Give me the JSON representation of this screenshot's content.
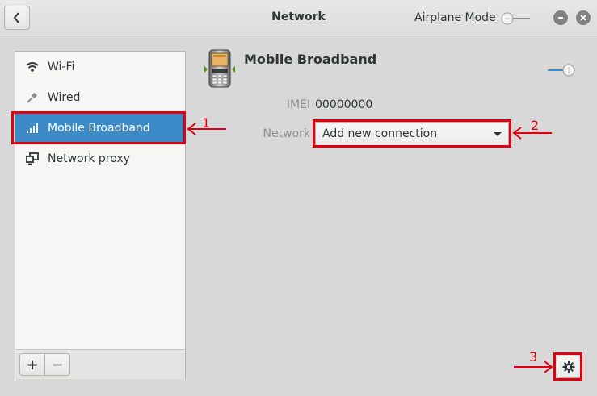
{
  "header": {
    "title": "Network",
    "airplane_mode_label": "Airplane Mode",
    "airplane_mode_on": false
  },
  "sidebar": {
    "items": [
      {
        "label": "Wi-Fi",
        "icon": "wifi-icon",
        "selected": false
      },
      {
        "label": "Wired",
        "icon": "wired-icon",
        "selected": false
      },
      {
        "label": "Mobile Broadband",
        "icon": "signal-bars-icon",
        "selected": true
      },
      {
        "label": "Network proxy",
        "icon": "network-proxy-icon",
        "selected": false
      }
    ],
    "toolbar": {
      "add_label": "+",
      "remove_label": "−"
    }
  },
  "main": {
    "section_title": "Mobile Broadband",
    "device_enabled": false,
    "imei_label": "IMEI",
    "imei_value": "00000000",
    "network_label": "Network",
    "network_value": "Add new connection"
  },
  "annotations": {
    "marker_1": "1",
    "marker_2": "2",
    "marker_3": "3",
    "color": "#e0000f"
  },
  "colors": {
    "selection": "#3d8ac9",
    "background": "#d8d8d8",
    "sidebar_bg": "#f6f6f5"
  }
}
